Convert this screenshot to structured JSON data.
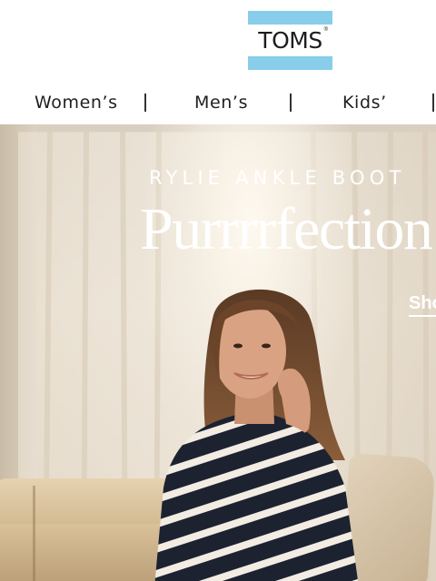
{
  "brand": {
    "logo_text": "TOMS",
    "logo_mark": "®",
    "logo_bar_color": "#88cde9"
  },
  "nav": {
    "items": [
      {
        "label": "Women’s"
      },
      {
        "label": "Men’s"
      },
      {
        "label": "Kids’"
      }
    ]
  },
  "hero": {
    "eyebrow": "RYLIE ANKLE BOOT",
    "headline": "Purrrrfection",
    "cta_label": "Shop"
  }
}
